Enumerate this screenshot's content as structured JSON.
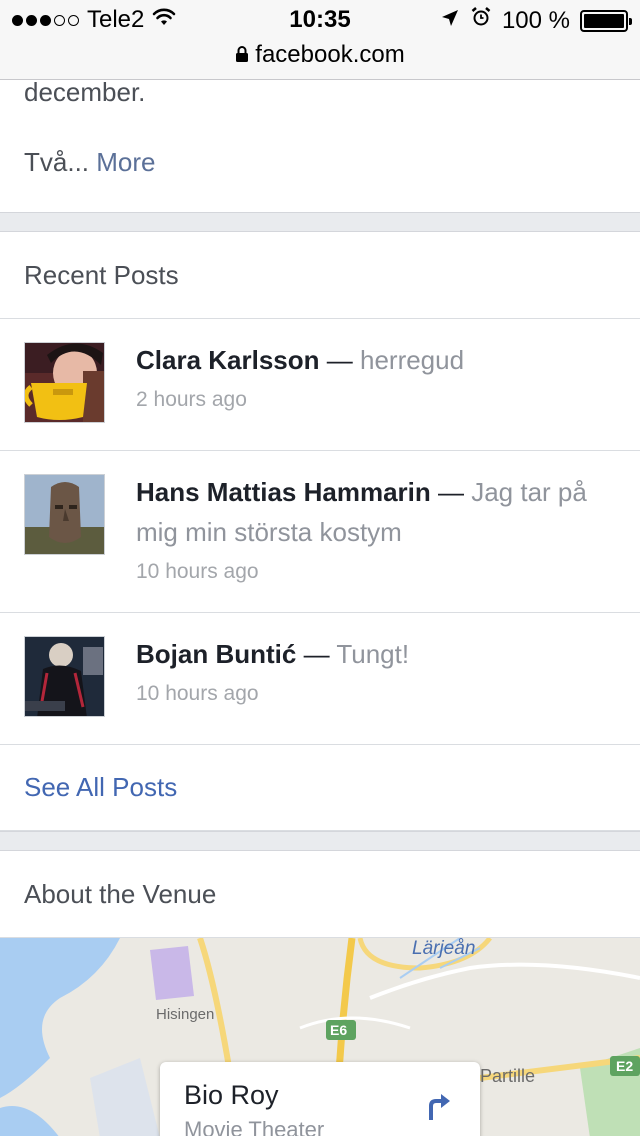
{
  "status_bar": {
    "carrier": "Tele2",
    "time": "10:35",
    "battery": "100 %",
    "battery_level": 1.0,
    "signal_bars_filled": 3,
    "signal_bars_total": 5,
    "icons": [
      "wifi-icon",
      "location-arrow-icon",
      "alarm-icon",
      "battery-icon"
    ]
  },
  "url_bar": {
    "domain": "facebook.com",
    "icon": "lock-icon"
  },
  "about_snippet": {
    "end_text": "december.",
    "truncated_text": "Två...",
    "more_label": "More"
  },
  "recent_posts": {
    "title": "Recent Posts",
    "posts": [
      {
        "author": "Clara Karlsson",
        "separator": " — ",
        "text": "herregud",
        "time": "2 hours ago"
      },
      {
        "author": "Hans Mattias Hammarin",
        "separator": " — ",
        "text": "Jag tar på mig min största kostym",
        "time": "10 hours ago"
      },
      {
        "author": "Bojan Buntić",
        "separator": " — ",
        "text": "Tungt!",
        "time": "10 hours ago"
      }
    ],
    "see_all_label": "See All Posts"
  },
  "about_venue": {
    "title": "About the Venue",
    "map_labels": [
      "Lärjeån",
      "Hisingen",
      "E6",
      "Partille",
      "E2"
    ],
    "venue_name": "Bio Roy",
    "venue_type": "Movie Theater",
    "directions_icon": "directions-arrow-icon"
  },
  "colors": {
    "link_blue": "#4267b2",
    "more_link": "#5b7098",
    "secondary_text": "#90949c",
    "separator_bg": "#e9ebee"
  }
}
